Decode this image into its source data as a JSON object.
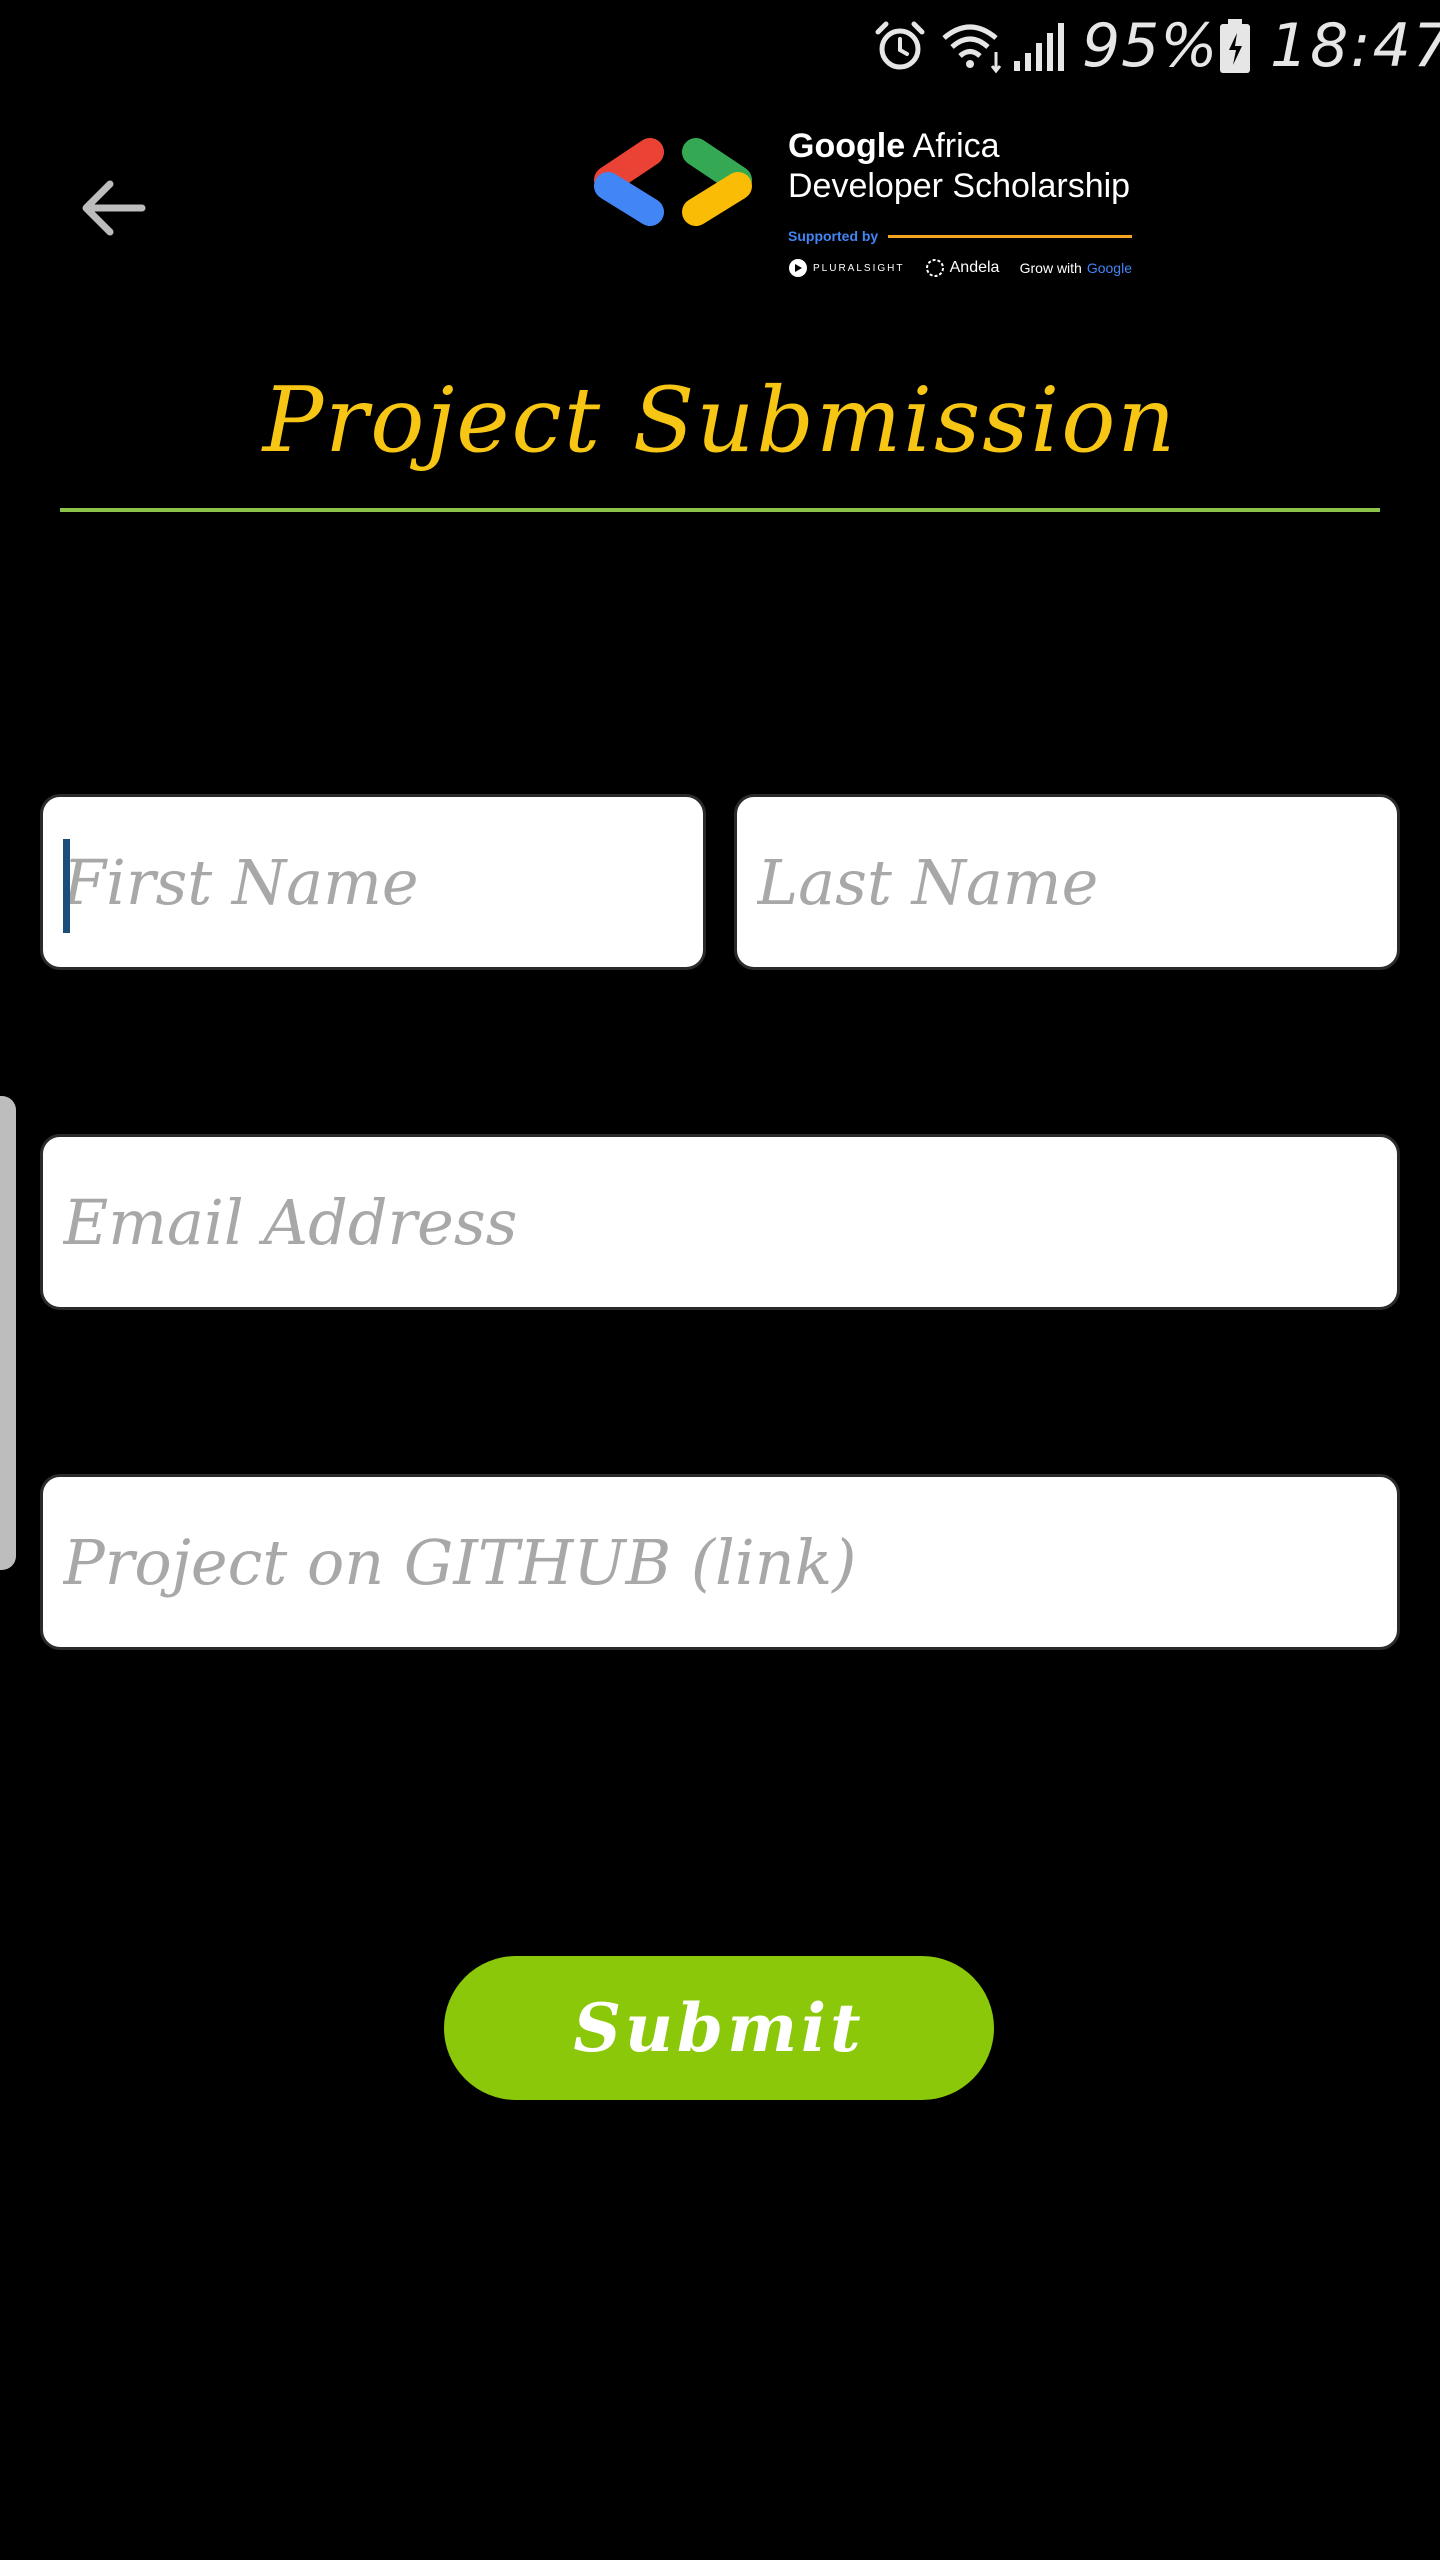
{
  "status_bar": {
    "battery_percent": "95%",
    "time": "18:47",
    "icons": [
      "alarm-icon",
      "wifi-icon",
      "signal-icon",
      "battery-icon"
    ]
  },
  "header": {
    "back_icon": "arrow-left-icon",
    "logo": {
      "brand": "Google",
      "line1_rest": " Africa",
      "line2": "Developer Scholarship",
      "supported_by": "Supported by",
      "partners": {
        "pluralsight": "PLURALSIGHT",
        "andela": "Andela",
        "grow_prefix": "Grow with ",
        "grow_google": "Google"
      }
    }
  },
  "page": {
    "title": "Project Submission"
  },
  "form": {
    "first_name_placeholder": "First Name",
    "last_name_placeholder": "Last Name",
    "email_placeholder": "Email Address",
    "github_placeholder": "Project on GITHUB (link)",
    "submit_label": "Submit"
  },
  "colors": {
    "background": "#000000",
    "title": "#f7c614",
    "divider": "#8bc34a",
    "submit": "#8bc80a",
    "placeholder": "#a8a8a8"
  }
}
